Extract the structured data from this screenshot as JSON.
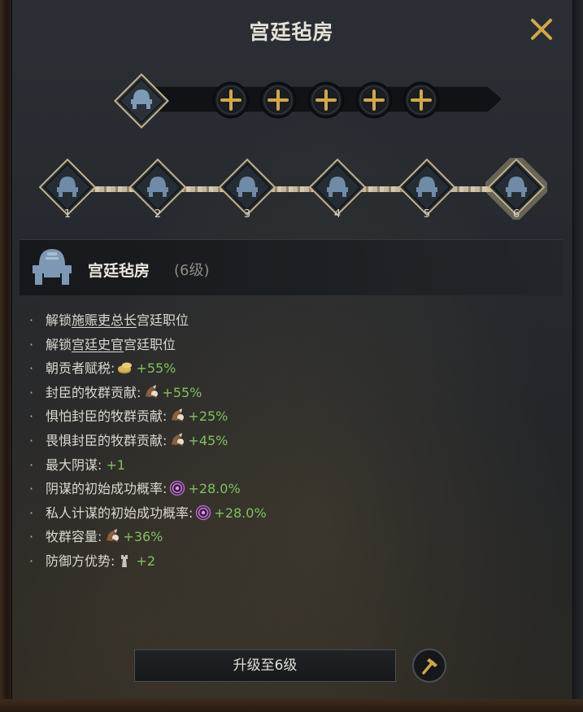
{
  "window": {
    "title": "宫廷毡房"
  },
  "levels": [
    "1",
    "2",
    "3",
    "4",
    "5",
    "6"
  ],
  "selected_level": "6",
  "detail": {
    "name": "宫廷毡房",
    "level_label": "(6级)"
  },
  "effects": [
    {
      "pre": "解锁",
      "link": "施赈吏总长",
      "post": "宫廷职位"
    },
    {
      "pre": "解锁",
      "link": "宫廷史官",
      "post": "宫廷职位"
    },
    {
      "label": "朝贡者赋税:",
      "icon": "gold-coins-icon",
      "value": "+55%"
    },
    {
      "label": "封臣的牧群贡献:",
      "icon": "herd-horse-icon",
      "value": "+55%"
    },
    {
      "label": "惧怕封臣的牧群贡献:",
      "icon": "herd-horse-icon",
      "value": "+25%"
    },
    {
      "label": "畏惧封臣的牧群贡献:",
      "icon": "herd-horse-icon",
      "value": "+45%"
    },
    {
      "label": "最大阴谋:",
      "icon": "",
      "value": "+1"
    },
    {
      "label": "阴谋的初始成功概率:",
      "icon": "scheme-target-icon",
      "value": "+28.0%"
    },
    {
      "label": "私人计谋的初始成功概率:",
      "icon": "scheme-target-icon",
      "value": "+28.0%"
    },
    {
      "label": "牧群容量:",
      "icon": "herd-horse-icon",
      "value": "+36%"
    },
    {
      "label": "防御方优势:",
      "icon": "defense-tower-icon",
      "value": "+2"
    }
  ],
  "upgrade_button": {
    "label": "升级至6级"
  },
  "colors": {
    "accent_gold": "#d2a64a",
    "positive": "#7fc15f",
    "node_blue": "#6f8ba7"
  }
}
